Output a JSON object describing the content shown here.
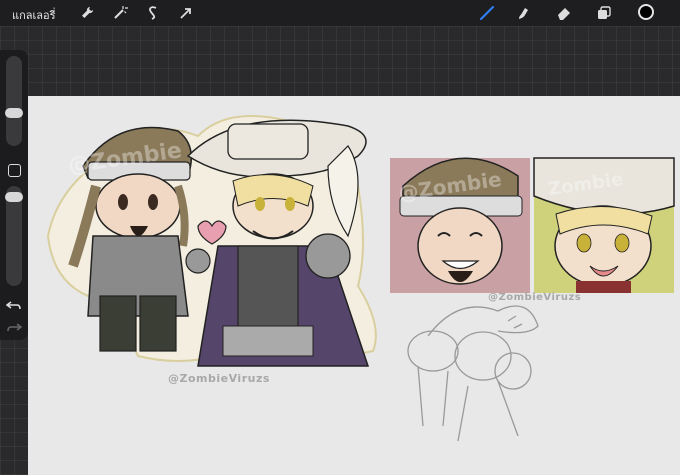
{
  "toolbar": {
    "gallery_label": "แกลเลอรี่",
    "icons": [
      "wrench-icon",
      "magic-wand-icon",
      "selection-icon",
      "transform-arrow-icon",
      "brush-icon",
      "smudge-icon",
      "eraser-icon",
      "layers-icon",
      "color-well"
    ],
    "active_color": "#000000",
    "brush_active_color": "#2f7df6"
  },
  "sidebar": {
    "buttons": [
      "brush-size-slider",
      "modify-button",
      "opacity-slider",
      "undo-button",
      "redo-button"
    ]
  },
  "artwork": {
    "watermark_main": "@ZombieViruzs",
    "watermark_secondary": "@ZombieViruzs",
    "overlay_text": "@Zombie",
    "overlay_text_2": "Zombie"
  },
  "colors": {
    "toolbar_bg": "#1e1e20",
    "canvas_bg": "#e8e8e8",
    "card1_bg": "#c9a0a3",
    "card2_bg": "#cfd27a",
    "hat_brown": "#8b7a5a",
    "hat_white": "#e9e5dc",
    "coat_gray": "#8a8a8a",
    "cape_purple": "#55456b",
    "sticker_outline": "#d9cf9e"
  }
}
